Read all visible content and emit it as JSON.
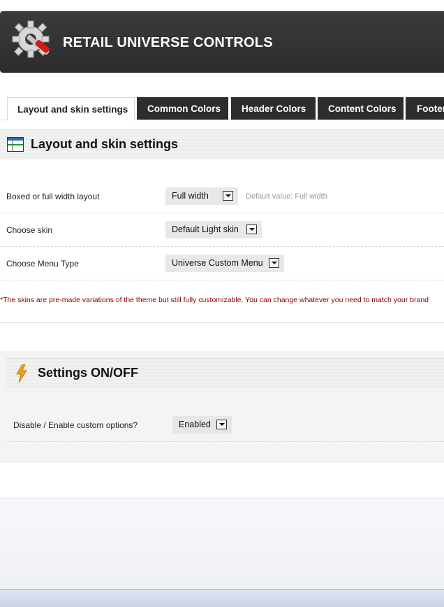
{
  "header": {
    "title": "RETAIL UNIVERSE CONTROLS",
    "logo_icon": "gear-wrench-icon"
  },
  "tabs": [
    {
      "label": "Layout and skin settings",
      "active": true
    },
    {
      "label": "Common Colors",
      "active": false
    },
    {
      "label": "Header Colors",
      "active": false
    },
    {
      "label": "Content Colors",
      "active": false
    },
    {
      "label": "Footer",
      "active": false
    }
  ],
  "layout_section": {
    "title": "Layout and skin settings",
    "icon": "layout-grid-icon",
    "rows": [
      {
        "label": "Boxed or full width layout",
        "value": "Full width",
        "hint": "Default value: Full width"
      },
      {
        "label": "Choose skin",
        "value": "Default Light skin",
        "hint": ""
      },
      {
        "label": "Choose Menu Type",
        "value": "Universe Custom Menu",
        "hint": ""
      }
    ],
    "note": "*The skins are pre-made variations of the theme but still fully customizable. You can change whatever you need to match your brand"
  },
  "settings_section": {
    "title": "Settings ON/OFF",
    "icon": "lightning-icon",
    "rows": [
      {
        "label": "Disable / Enable custom options?",
        "value": "Enabled"
      }
    ]
  },
  "colors": {
    "header_bg": "#333333",
    "tab_dark": "#2d2d2d",
    "note_red": "#8b0000"
  }
}
